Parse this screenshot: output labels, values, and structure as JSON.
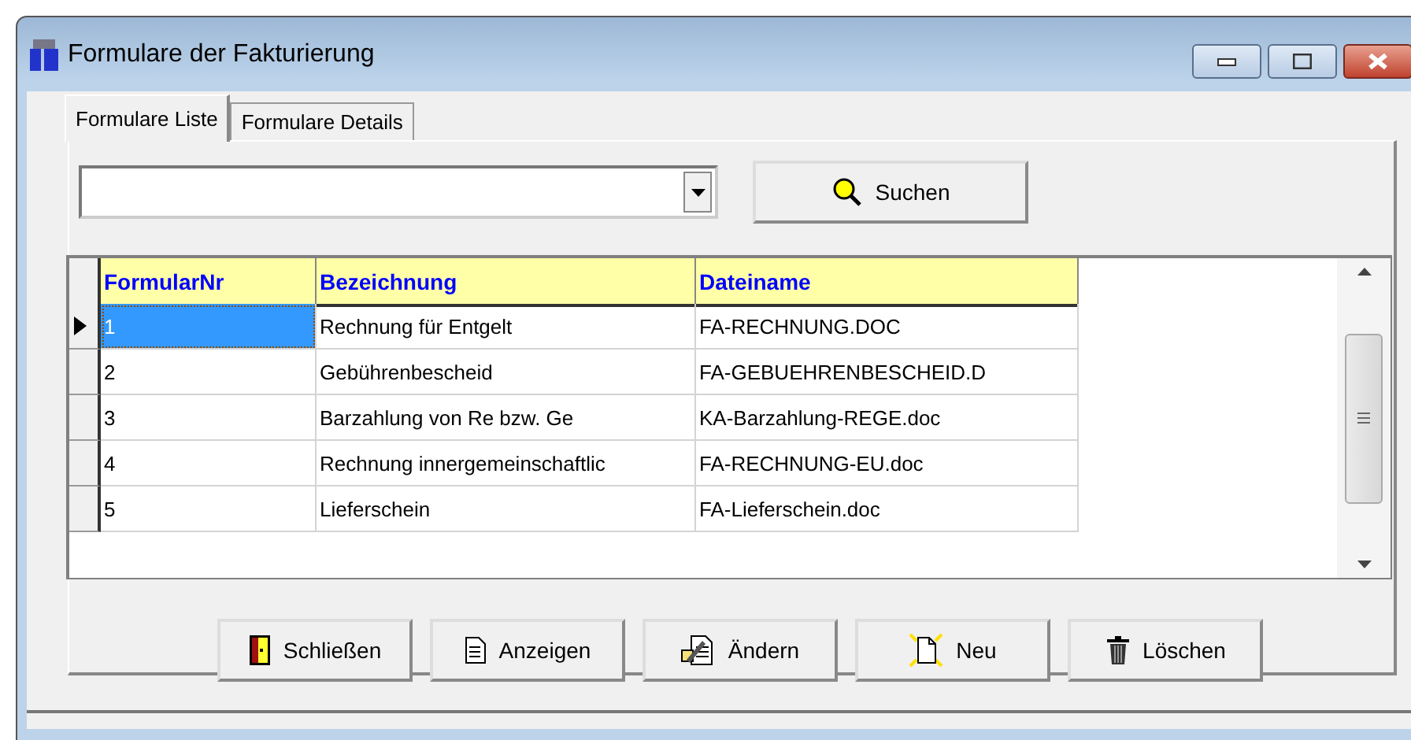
{
  "window": {
    "title": "Formulare der Fakturierung"
  },
  "tabs": [
    {
      "label": "Formulare Liste",
      "selected": true
    },
    {
      "label": "Formulare Details",
      "selected": false
    }
  ],
  "search": {
    "button": "Suchen"
  },
  "table": {
    "columns": [
      "FormularNr",
      "Bezeichnung",
      "Dateiname"
    ],
    "rows": [
      {
        "cells": [
          "1",
          "Rechnung für Entgelt",
          "FA-RECHNUNG.DOC"
        ],
        "selected": true
      },
      {
        "cells": [
          "2",
          "Gebührenbescheid",
          "FA-GEBUEHRENBESCHEID.D"
        ],
        "selected": false
      },
      {
        "cells": [
          "3",
          "Barzahlung von Re bzw. Ge",
          "KA-Barzahlung-REGE.doc"
        ],
        "selected": false
      },
      {
        "cells": [
          "4",
          "Rechnung innergemeinschaftlic",
          "FA-RECHNUNG-EU.doc"
        ],
        "selected": false
      },
      {
        "cells": [
          "5",
          "Lieferschein",
          "FA-Lieferschein.doc"
        ],
        "selected": false
      }
    ]
  },
  "buttons": [
    {
      "label": "Schließen",
      "kind": "close"
    },
    {
      "label": "Anzeigen",
      "kind": "view"
    },
    {
      "label": "Ändern",
      "kind": "edit"
    },
    {
      "label": "Neu",
      "kind": "new"
    },
    {
      "label": "Löschen",
      "kind": "delete"
    }
  ]
}
